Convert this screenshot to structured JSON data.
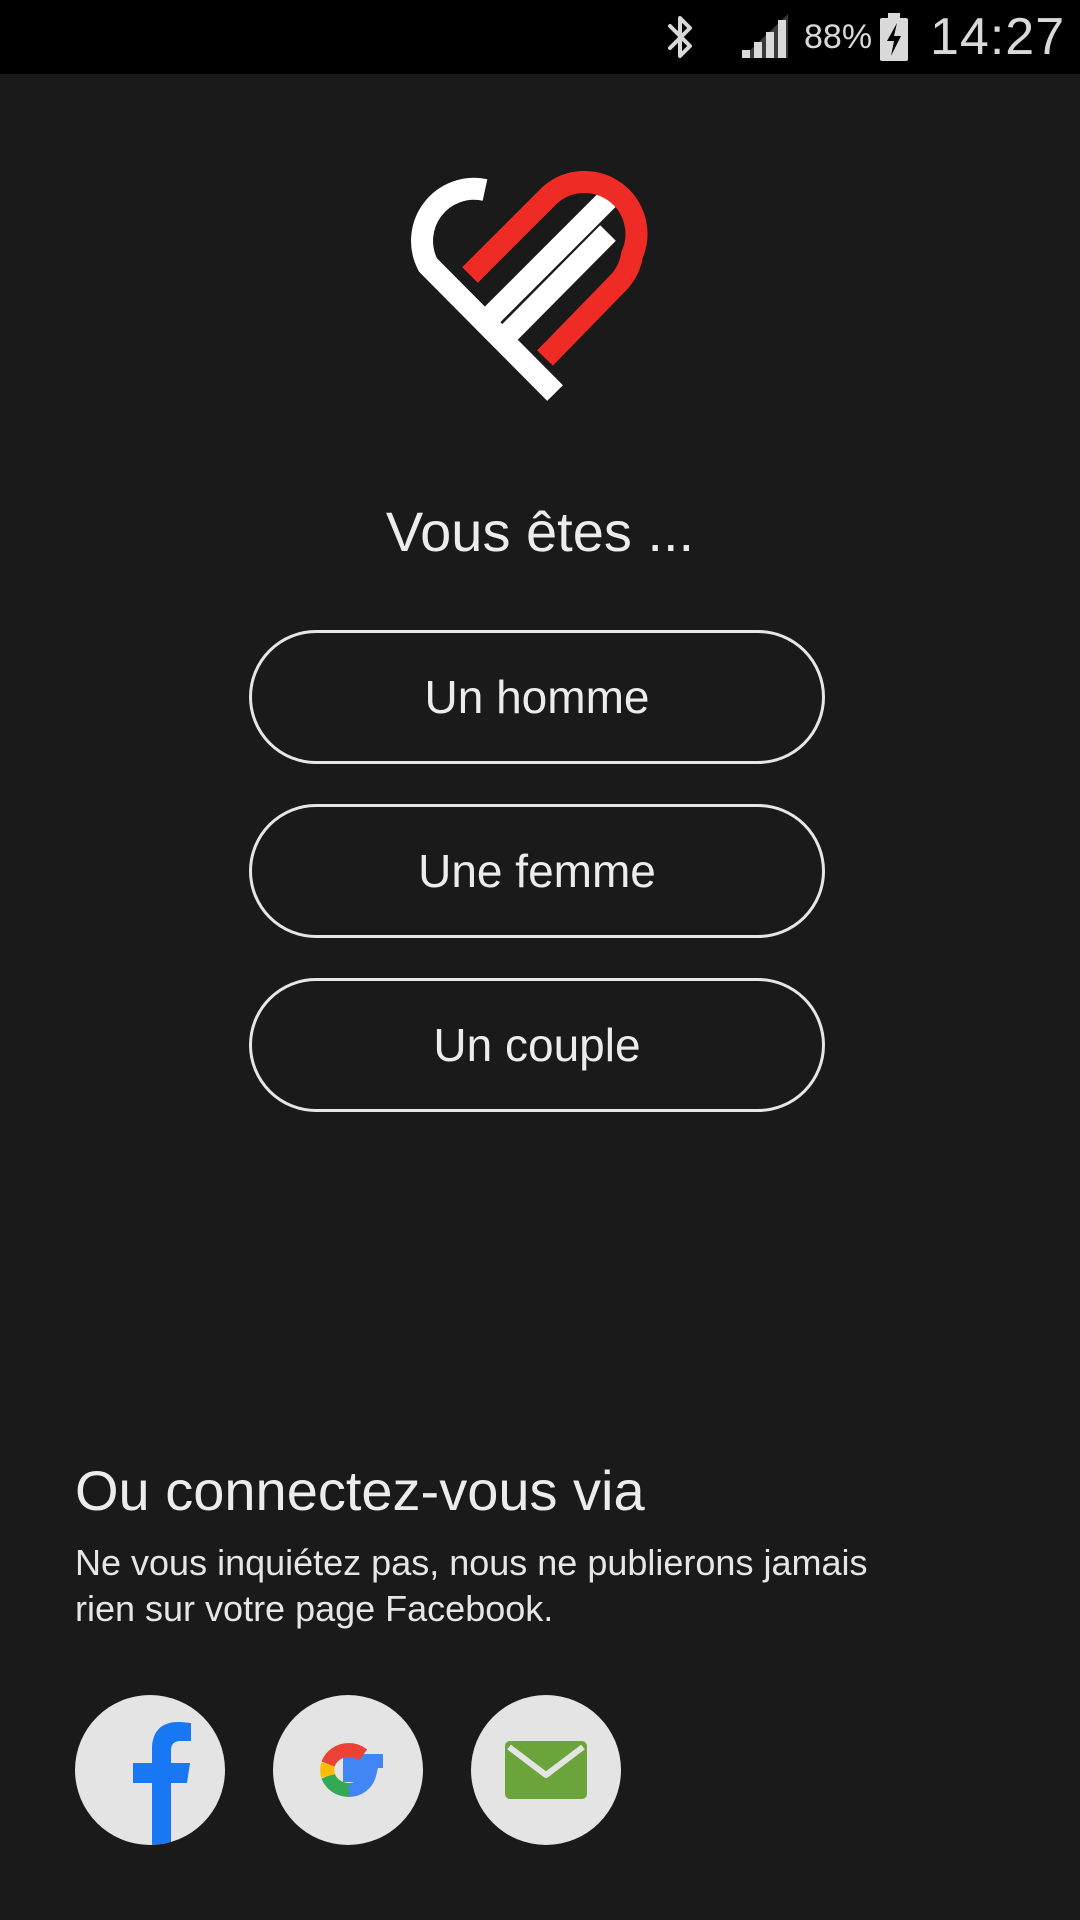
{
  "status_bar": {
    "battery_percent": "88%",
    "time": "14:27",
    "icons": [
      "bluetooth-icon",
      "signal-icon",
      "battery-charging-icon"
    ]
  },
  "logo": {
    "name": "app-heart-logo",
    "colors": {
      "red": "#ee2b24",
      "white": "#ffffff"
    }
  },
  "gender_prompt": {
    "question": "Vous êtes ...",
    "options": [
      "Un homme",
      "Une femme",
      "Un couple"
    ]
  },
  "social_login": {
    "title": "Ou connectez-vous via",
    "note": "Ne vous inquiétez pas, nous ne publierons jamais rien sur votre page Facebook.",
    "providers": [
      {
        "icon": "facebook-icon",
        "color": "#1877f2"
      },
      {
        "icon": "google-icon",
        "colors": [
          "#ea4335",
          "#fbbc05",
          "#34a853",
          "#4285f4"
        ]
      },
      {
        "icon": "mail-icon",
        "color": "#6aa43a"
      }
    ]
  },
  "colors": {
    "background": "#1a1a1a",
    "status_bar": "#000000",
    "text": "#ececec",
    "button_border": "#e6e6e6",
    "social_button_bg": "#e4e4e4"
  }
}
